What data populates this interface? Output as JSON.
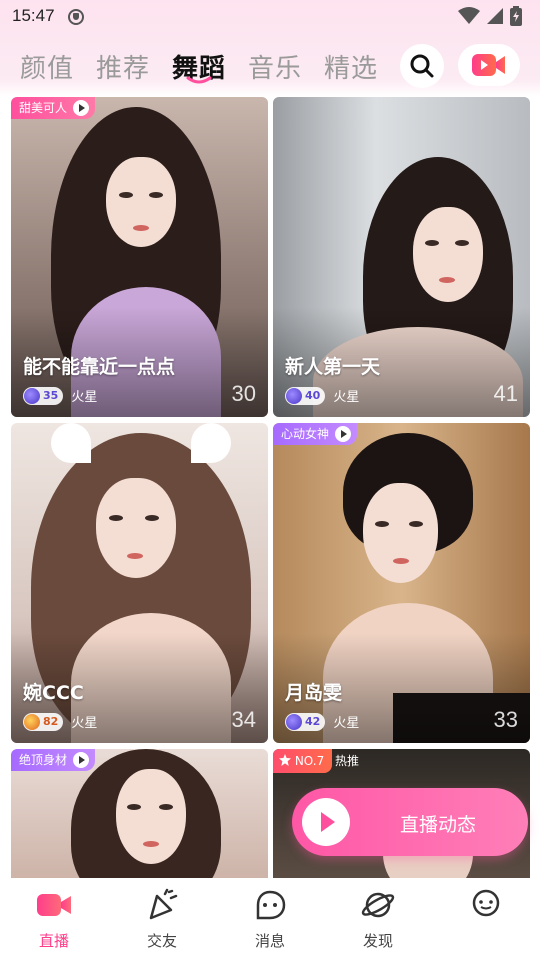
{
  "status_bar": {
    "time": "15:47"
  },
  "tabs": [
    {
      "label": "颜值"
    },
    {
      "label": "推荐"
    },
    {
      "label": "舞蹈"
    },
    {
      "label": "音乐"
    },
    {
      "label": "精选"
    }
  ],
  "active_tab": "舞蹈",
  "header_icons": [
    "search-icon",
    "live-camera-icon"
  ],
  "cards": [
    {
      "tag": "甜美可人",
      "name": "能不能靠近一点点",
      "level": "35",
      "planet": "火星",
      "count": "30"
    },
    {
      "tag": "",
      "name": "新人第一天",
      "level": "40",
      "planet": "火星",
      "count": "41"
    },
    {
      "tag": "",
      "name": "婉CCC",
      "level": "82",
      "planet": "火星",
      "count": "34"
    },
    {
      "tag": "心动女神",
      "name": "月岛雯",
      "level": "42",
      "planet": "火星",
      "count": "33"
    },
    {
      "tag": "绝顶身材",
      "name": "",
      "level": "",
      "planet": "",
      "count": ""
    },
    {
      "tag": "NO.7",
      "hot": "热推",
      "name": "",
      "level": "",
      "planet": "",
      "count": ""
    }
  ],
  "floating_button": {
    "label": "直播动态"
  },
  "bottom_nav": [
    {
      "label": "直播",
      "icon": "live-camera-icon"
    },
    {
      "label": "交友",
      "icon": "party-horn-icon"
    },
    {
      "label": "消息",
      "icon": "message-bubble-icon"
    },
    {
      "label": "发现",
      "icon": "planet-icon"
    },
    {
      "label": "",
      "icon": "smiley-bubble-icon"
    }
  ],
  "colors": {
    "accent": "#ff3d8b",
    "tab_active": "#111111",
    "tab_inactive": "#9a9a9a"
  }
}
